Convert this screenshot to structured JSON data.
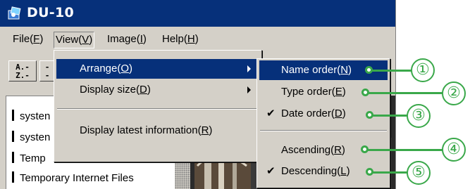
{
  "window": {
    "title": "DU-10",
    "menus": [
      {
        "label": "File",
        "key": "F"
      },
      {
        "label": "View",
        "key": "V"
      },
      {
        "label": "Image",
        "key": "I"
      },
      {
        "label": "Help",
        "key": "H"
      }
    ]
  },
  "toolbar": {
    "buttons": [
      {
        "top": "A.-",
        "bottom": "Z.-",
        "icon": "sort-az-icon"
      },
      {
        "top": "-",
        "bottom": "-",
        "icon": "sort-icon"
      }
    ]
  },
  "folder_tree": {
    "items": [
      "systen",
      "systen",
      "Temp",
      "Temporary Internet Files"
    ]
  },
  "view_menu": {
    "items": [
      {
        "label": "Arrange",
        "key": "O",
        "submenu": true,
        "highlighted": true
      },
      {
        "label": "Display size",
        "key": "D",
        "submenu": true,
        "highlighted": false
      },
      {
        "label": "Display latest information",
        "key": "R",
        "submenu": false,
        "highlighted": false
      }
    ]
  },
  "arrange_menu": {
    "items": [
      {
        "label": "Name order",
        "key": "N",
        "checked": false,
        "highlighted": true,
        "callout": "①"
      },
      {
        "label": "Type order",
        "key": "E",
        "checked": false,
        "highlighted": false,
        "callout": "②"
      },
      {
        "label": "Date order",
        "key": "D",
        "checked": true,
        "highlighted": false,
        "callout": "③"
      },
      {
        "label": "Ascending",
        "key": "R",
        "checked": false,
        "highlighted": false,
        "callout": "④"
      },
      {
        "label": "Descending",
        "key": "L",
        "checked": true,
        "highlighted": false,
        "callout": "⑤"
      }
    ]
  },
  "colors": {
    "title_bar": "#06307a",
    "highlight": "#06307a",
    "face": "#d4d0c8",
    "callout": "#3aa84a"
  }
}
